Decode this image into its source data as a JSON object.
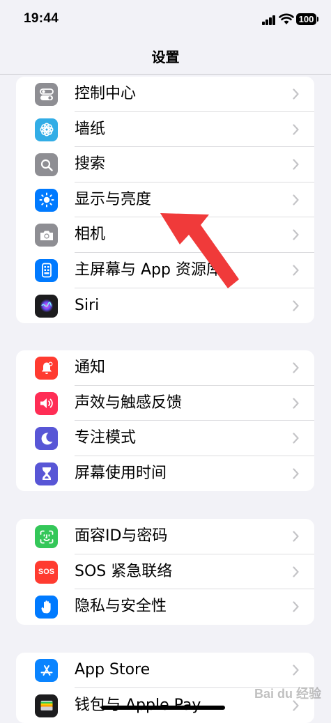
{
  "status_bar": {
    "time": "19:44",
    "battery": "100"
  },
  "nav": {
    "title": "设置"
  },
  "groups": [
    {
      "items": [
        {
          "label": "控制中心",
          "icon": "toggle-icon",
          "color": "#8e8e93"
        },
        {
          "label": "墙纸",
          "icon": "flower-icon",
          "color": "#32ade6"
        },
        {
          "label": "搜索",
          "icon": "search-icon",
          "color": "#8e8e93"
        },
        {
          "label": "显示与亮度",
          "icon": "sun-icon",
          "color": "#007aff"
        },
        {
          "label": "相机",
          "icon": "camera-icon",
          "color": "#8e8e93"
        },
        {
          "label": "主屏幕与 App 资源库",
          "icon": "home-screen-icon",
          "color": "#007aff"
        },
        {
          "label": "Siri",
          "icon": "siri-icon",
          "color": "#1c1c1e"
        }
      ]
    },
    {
      "items": [
        {
          "label": "通知",
          "icon": "bell-icon",
          "color": "#ff3b30"
        },
        {
          "label": "声效与触感反馈",
          "icon": "speaker-icon",
          "color": "#ff2d55"
        },
        {
          "label": "专注模式",
          "icon": "moon-icon",
          "color": "#5856d6"
        },
        {
          "label": "屏幕使用时间",
          "icon": "hourglass-icon",
          "color": "#5856d6"
        }
      ]
    },
    {
      "items": [
        {
          "label": "面容ID与密码",
          "icon": "face-id-icon",
          "color": "#34c759"
        },
        {
          "label": "SOS 紧急联络",
          "icon": "sos-icon",
          "color": "#ff3b30",
          "icon_text": "SOS"
        },
        {
          "label": "隐私与安全性",
          "icon": "hand-icon",
          "color": "#007aff"
        }
      ]
    },
    {
      "items": [
        {
          "label": "App Store",
          "icon": "app-store-icon",
          "color": "#0a84ff"
        },
        {
          "label": "钱包与 Apple Pay",
          "icon": "wallet-icon",
          "color": "#1c1c1e"
        }
      ]
    }
  ],
  "watermark": "Bai du 经验"
}
